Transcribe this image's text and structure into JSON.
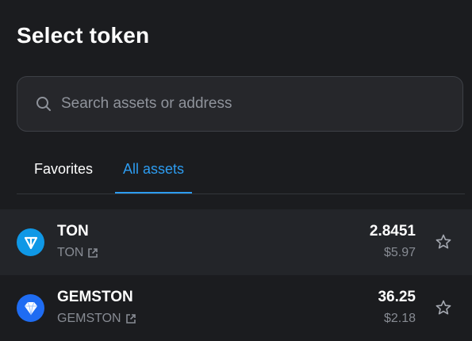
{
  "header": {
    "title": "Select token"
  },
  "search": {
    "placeholder": "Search assets or address",
    "value": ""
  },
  "tabs": [
    {
      "label": "Favorites",
      "active": false
    },
    {
      "label": "All assets",
      "active": true
    }
  ],
  "tokens": [
    {
      "name": "TON",
      "ticker": "TON",
      "amount": "2.8451",
      "usd": "$5.97",
      "icon": "ton-logo-icon",
      "color": "#0f98e6"
    },
    {
      "name": "GEMSTON",
      "ticker": "GEMSTON",
      "amount": "36.25",
      "usd": "$2.18",
      "icon": "gem-logo-icon",
      "color": "#1f6cf2"
    }
  ],
  "colors": {
    "accent": "#2d9cf0",
    "background": "#1b1c1f",
    "row_highlight": "#232529"
  }
}
